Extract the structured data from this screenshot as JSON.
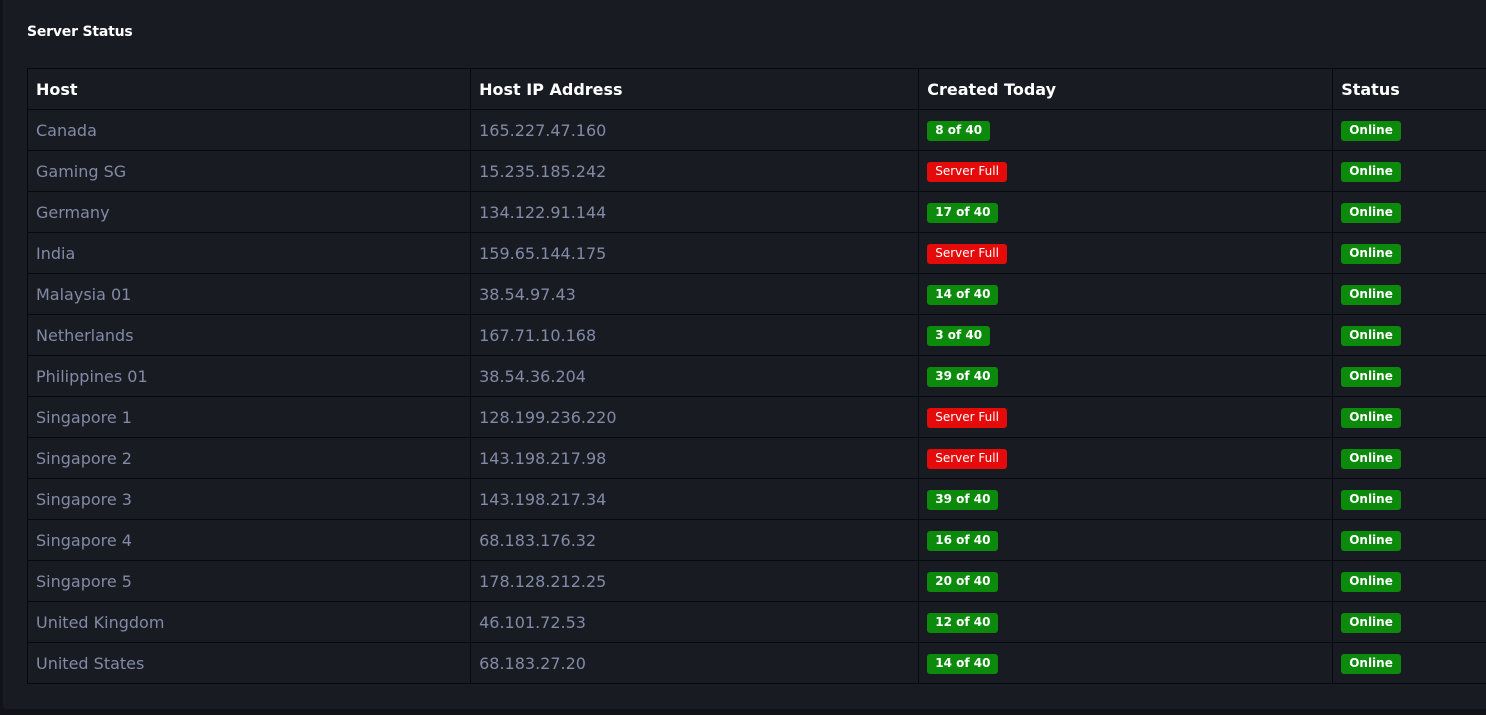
{
  "panel": {
    "title": "Server Status"
  },
  "colors": {
    "background": "#191b22",
    "text_muted": "#838aa6",
    "badge_green": "#0b8a0b",
    "badge_red": "#e50b0b"
  },
  "table": {
    "columns": [
      "Host",
      "Host IP Address",
      "Created Today",
      "Status"
    ],
    "rows": [
      {
        "host": "Canada",
        "ip": "165.227.47.160",
        "created": "8 of 40",
        "created_state": "ok",
        "status": "Online"
      },
      {
        "host": "Gaming SG",
        "ip": "15.235.185.242",
        "created": "Server Full",
        "created_state": "full",
        "status": "Online"
      },
      {
        "host": "Germany",
        "ip": "134.122.91.144",
        "created": "17 of 40",
        "created_state": "ok",
        "status": "Online"
      },
      {
        "host": "India",
        "ip": "159.65.144.175",
        "created": "Server Full",
        "created_state": "full",
        "status": "Online"
      },
      {
        "host": "Malaysia 01",
        "ip": "38.54.97.43",
        "created": "14 of 40",
        "created_state": "ok",
        "status": "Online"
      },
      {
        "host": "Netherlands",
        "ip": "167.71.10.168",
        "created": "3 of 40",
        "created_state": "ok",
        "status": "Online"
      },
      {
        "host": "Philippines 01",
        "ip": "38.54.36.204",
        "created": "39 of 40",
        "created_state": "ok",
        "status": "Online"
      },
      {
        "host": "Singapore 1",
        "ip": "128.199.236.220",
        "created": "Server Full",
        "created_state": "full",
        "status": "Online"
      },
      {
        "host": "Singapore 2",
        "ip": "143.198.217.98",
        "created": "Server Full",
        "created_state": "full",
        "status": "Online"
      },
      {
        "host": "Singapore 3",
        "ip": "143.198.217.34",
        "created": "39 of 40",
        "created_state": "ok",
        "status": "Online"
      },
      {
        "host": "Singapore 4",
        "ip": "68.183.176.32",
        "created": "16 of 40",
        "created_state": "ok",
        "status": "Online"
      },
      {
        "host": "Singapore 5",
        "ip": "178.128.212.25",
        "created": "20 of 40",
        "created_state": "ok",
        "status": "Online"
      },
      {
        "host": "United Kingdom",
        "ip": "46.101.72.53",
        "created": "12 of 40",
        "created_state": "ok",
        "status": "Online"
      },
      {
        "host": "United States",
        "ip": "68.183.27.20",
        "created": "14 of 40",
        "created_state": "ok",
        "status": "Online"
      }
    ]
  }
}
